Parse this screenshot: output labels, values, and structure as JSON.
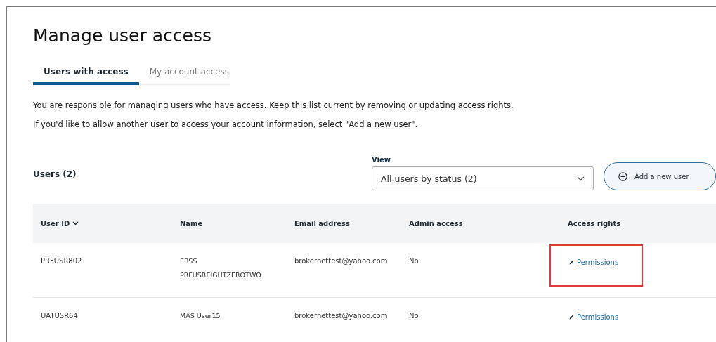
{
  "title": "Manage user access",
  "tabs": [
    {
      "label": "Users with access",
      "selected": true
    },
    {
      "label": "My account access",
      "selected": false
    }
  ],
  "intro": [
    "You are responsible for managing users who have access. Keep this list current by removing or updating access rights.",
    "If you'd like to allow another user to access your account information, select \"Add a new user\"."
  ],
  "users_heading": "Users (2)",
  "view": {
    "label": "View",
    "value": "All users by status (2)"
  },
  "add_button": "Add a new user",
  "table": {
    "columns": [
      {
        "label": "User ID",
        "sorted": true
      },
      {
        "label": "Name",
        "sorted": false
      },
      {
        "label": "Email address",
        "sorted": false
      },
      {
        "label": "Admin access",
        "sorted": false
      },
      {
        "label": "Access rights",
        "sorted": false
      }
    ],
    "rows": [
      {
        "user_id": "PRFUSR802",
        "name": "EBSS PRFUSREIGHTZEROTWO",
        "email": "brokernettest@yahoo.com",
        "admin": "No",
        "access": "Permissions",
        "highlighted": true
      },
      {
        "user_id": "UATUSR64",
        "name": "MAS User15",
        "email": "brokernettest@yahoo.com",
        "admin": "No",
        "access": "Permissions",
        "highlighted": false
      }
    ]
  }
}
